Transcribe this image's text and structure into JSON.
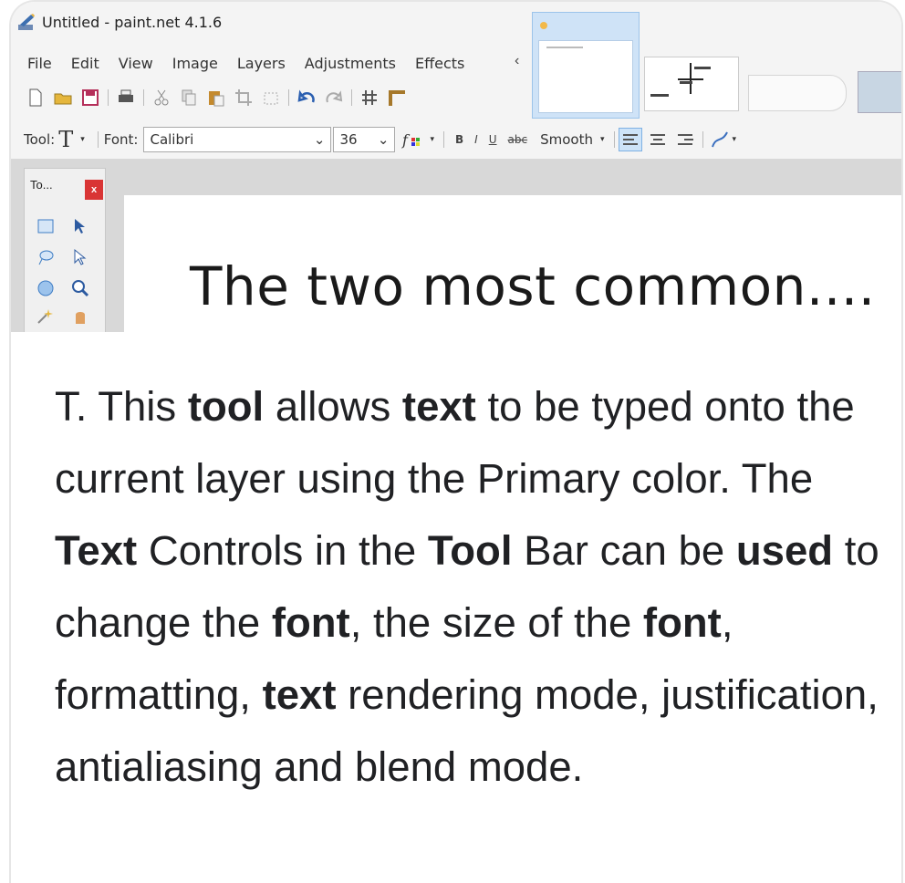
{
  "window": {
    "title": "Untitled - paint.net 4.1.6"
  },
  "menu": {
    "items": [
      "File",
      "Edit",
      "View",
      "Image",
      "Layers",
      "Adjustments",
      "Effects"
    ],
    "collapse_glyph": "‹"
  },
  "toolbar": {
    "tool_label": "Tool:",
    "tool_glyph": "T",
    "dropdown_glyph": "▾",
    "font_label": "Font:",
    "font_value": "Calibri",
    "size_value": "36",
    "bold": "B",
    "italic": "I",
    "underline": "U",
    "strike": "abc",
    "antialias_value": "Smooth",
    "select_arrow": "⌄"
  },
  "tools_window": {
    "title": "To...",
    "close": "x"
  },
  "canvas": {
    "text": "The two most common...."
  },
  "description": {
    "segments": [
      {
        "text": "T. This ",
        "bold": false
      },
      {
        "text": "tool",
        "bold": true
      },
      {
        "text": " allows ",
        "bold": false
      },
      {
        "text": "text",
        "bold": true
      },
      {
        "text": " to be typed onto the current layer using the Primary color. The ",
        "bold": false
      },
      {
        "text": "Text",
        "bold": true
      },
      {
        "text": " Controls in the ",
        "bold": false
      },
      {
        "text": "Tool",
        "bold": true
      },
      {
        "text": " Bar can be ",
        "bold": false
      },
      {
        "text": "used",
        "bold": true
      },
      {
        "text": " to change the ",
        "bold": false
      },
      {
        "text": "font",
        "bold": true
      },
      {
        "text": ", the size of the ",
        "bold": false
      },
      {
        "text": "font",
        "bold": true
      },
      {
        "text": ", formatting, ",
        "bold": false
      },
      {
        "text": "text",
        "bold": true
      },
      {
        "text": " rendering mode, justification, antialiasing and blend mode.",
        "bold": false
      }
    ]
  },
  "colors": {
    "accent": "#cfe3f7",
    "close_red": "#d93535",
    "text": "#202124"
  }
}
